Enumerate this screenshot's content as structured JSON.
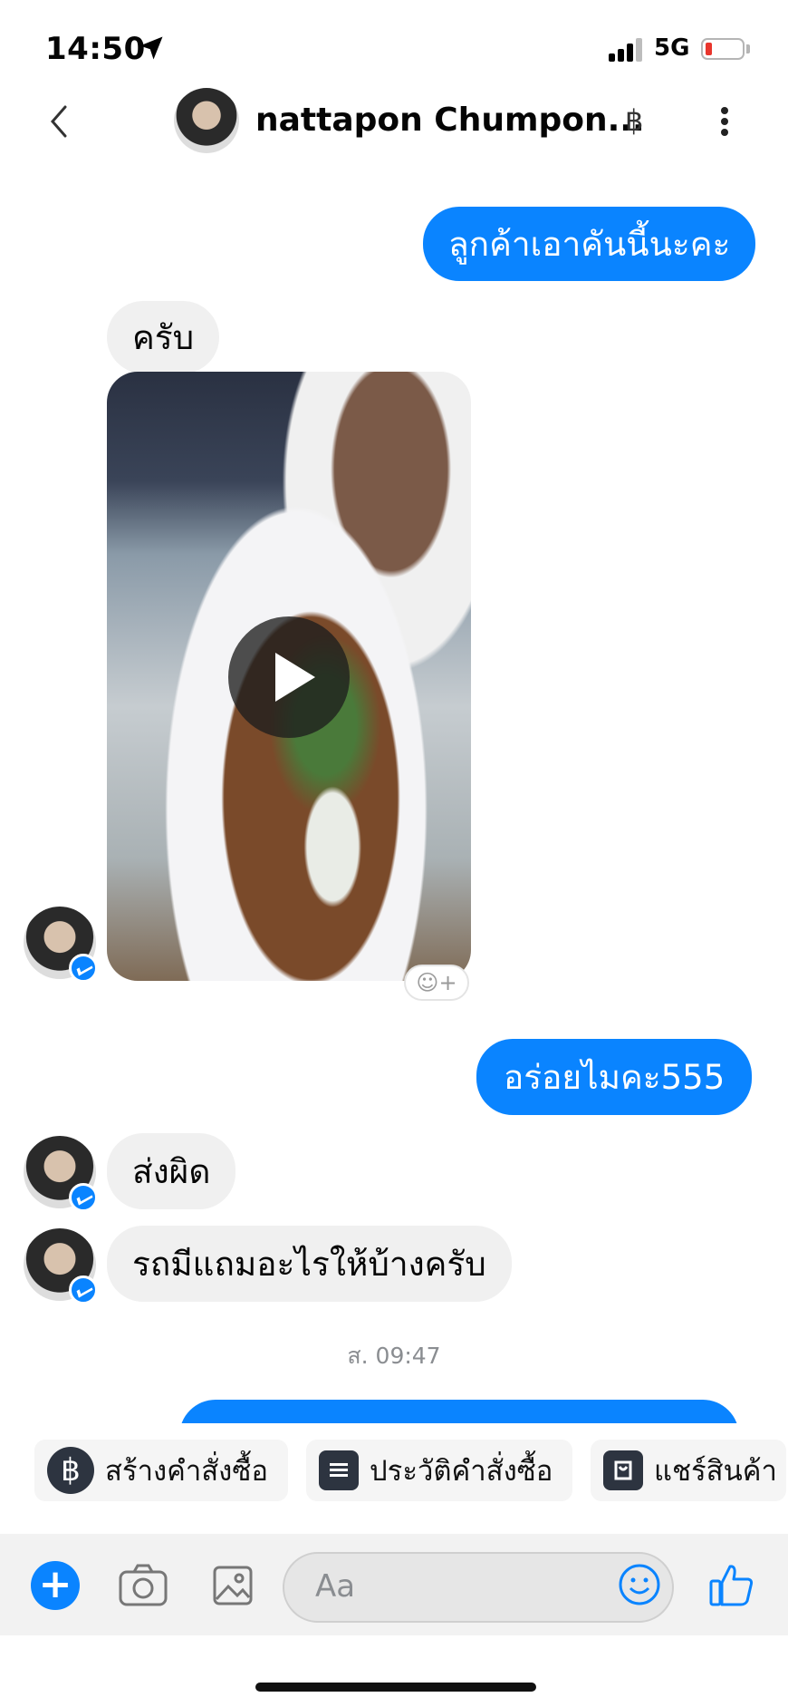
{
  "status_bar": {
    "time": "14:50",
    "network": "5G"
  },
  "header": {
    "contact_name": "nattapon Chumpon...",
    "badge_symbol": "฿"
  },
  "messages": [
    {
      "direction": "outgoing",
      "text": "ลูกค้าเอาคันนี้นะคะ"
    },
    {
      "direction": "incoming",
      "text": "ครับ"
    },
    {
      "direction": "incoming",
      "type": "video",
      "icon": "play-icon"
    },
    {
      "direction": "outgoing",
      "text": "อร่อยไมคะ555"
    },
    {
      "direction": "incoming",
      "text": "ส่งผิด"
    },
    {
      "direction": "incoming",
      "text": "รถมีแถมอะไรให้บ้างครับ"
    }
  ],
  "timestamp": "ส. 09:47",
  "quick_actions": [
    {
      "label": "สร้างคำสั่งซื้อ",
      "icon": "baht-icon",
      "glyph": "฿"
    },
    {
      "label": "ประวัติคำสั่งซื้อ",
      "icon": "order-history-icon"
    },
    {
      "label": "แชร์สินค้า",
      "icon": "shop-bag-icon"
    }
  ],
  "composer": {
    "placeholder": "Aa"
  },
  "colors": {
    "accent": "#0a84ff",
    "incoming_bubble": "#f0f0f0",
    "battery_low": "#e8352c"
  }
}
